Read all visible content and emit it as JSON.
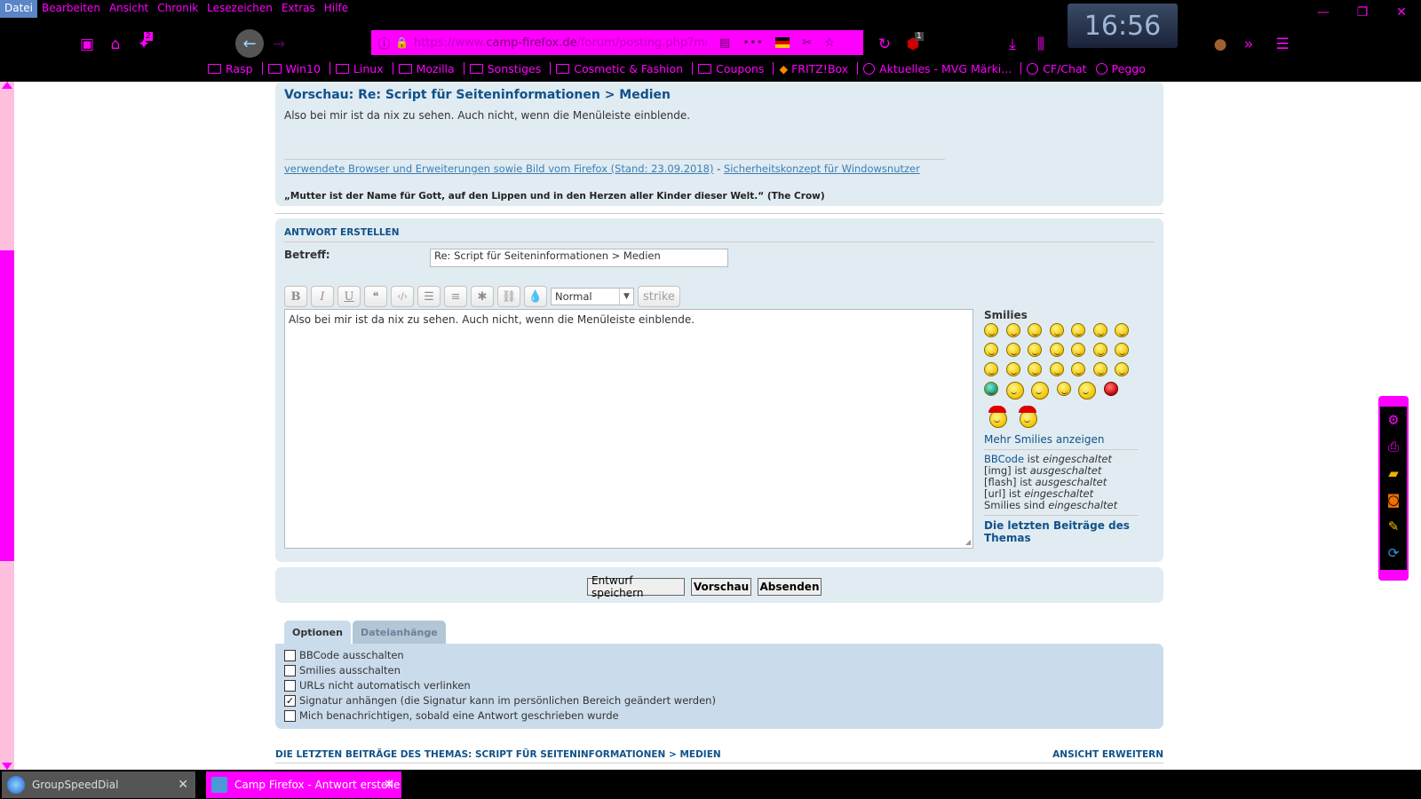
{
  "menubar": [
    "Datei",
    "Bearbeiten",
    "Ansicht",
    "Chronik",
    "Lesezeichen",
    "Extras",
    "Hilfe"
  ],
  "clock": "16:56",
  "toolbar": {
    "badge_a": "2",
    "badge_b": "1",
    "url_prefix": "https://www.",
    "url_domain": "camp-firefox.de",
    "url_path": "/forum/posting.php?mo"
  },
  "bookmarks": [
    "Rasp",
    "Win10",
    "Linux",
    "Mozilla",
    "Sonstiges",
    "Cosmetic & Fashion",
    "Coupons",
    "FRITZ!Box",
    "Aktuelles - MVG Märki...",
    "CF/Chat",
    "Peggo"
  ],
  "preview": {
    "title": "Vorschau: Re: Script für Seiteninformationen > Medien",
    "message": "Also bei mir ist da nix zu sehen. Auch nicht, wenn die Menüleiste einblende.",
    "sig_link_1": "verwendete Browser und Erweiterungen sowie Bild vom Firefox (Stand: 23.09.2018)",
    "sig_dash": " - ",
    "sig_link_2": "Sicherheitskonzept für Windowsnutzer",
    "quote": "„Mutter ist der Name für Gott, auf den Lippen und in den Herzen aller Kinder dieser Welt.“ (The Crow)"
  },
  "reply": {
    "heading": "ANTWORT ERSTELLEN",
    "subject_label": "Betreff:",
    "subject_value": "Re: Script für Seiteninformationen > Medien",
    "toolbar_buttons": [
      "B",
      "I",
      "U",
      "❝",
      "‹/›",
      "☰",
      "≡",
      "✱",
      "⛓",
      "💧"
    ],
    "fontsize_value": "Normal",
    "strike_label": "strike",
    "message_value": "Also bei mir ist da nix zu sehen. Auch nicht, wenn die Menüleiste einblende."
  },
  "smilies": {
    "title": "Smilies",
    "more": "Mehr Smilies anzeigen",
    "bbcode": [
      "BBCode",
      " ist ",
      "eingeschaltet"
    ],
    "img": [
      "[img] ist ",
      "ausgeschaltet"
    ],
    "flash": [
      "[flash] ist ",
      "ausgeschaltet"
    ],
    "url": [
      "[url] ist ",
      "eingeschaltet"
    ],
    "smilies_state": [
      "Smilies sind ",
      "eingeschaltet"
    ],
    "last_posts": "Die letzten Beiträge des Themas"
  },
  "buttons": {
    "draft": "Entwurf speichern",
    "preview": "Vorschau",
    "submit": "Absenden"
  },
  "tabs": [
    "Optionen",
    "Dateianhänge"
  ],
  "options": [
    {
      "label": "BBCode ausschalten",
      "checked": false
    },
    {
      "label": "Smilies ausschalten",
      "checked": false
    },
    {
      "label": "URLs nicht automatisch verlinken",
      "checked": false
    },
    {
      "label": "Signatur anhängen (die Signatur kann im persönlichen Bereich geändert werden)",
      "checked": true
    },
    {
      "label": "Mich benachrichtigen, sobald eine Antwort geschrieben wurde",
      "checked": false
    }
  ],
  "last_posts_heading": "DIE LETZTEN BEITRÄGE DES THEMAS: SCRIPT FÜR SEITENINFORMATIONEN > MEDIEN",
  "expand_view": "ANSICHT ERWEITERN",
  "taskbar": {
    "task_1": "GroupSpeedDial",
    "task_2": "Camp Firefox - Antwort erstelle"
  },
  "colors": {
    "accent": "#ff00ff",
    "forum_blue": "#105289",
    "panel_bg": "#e1ebf2"
  }
}
